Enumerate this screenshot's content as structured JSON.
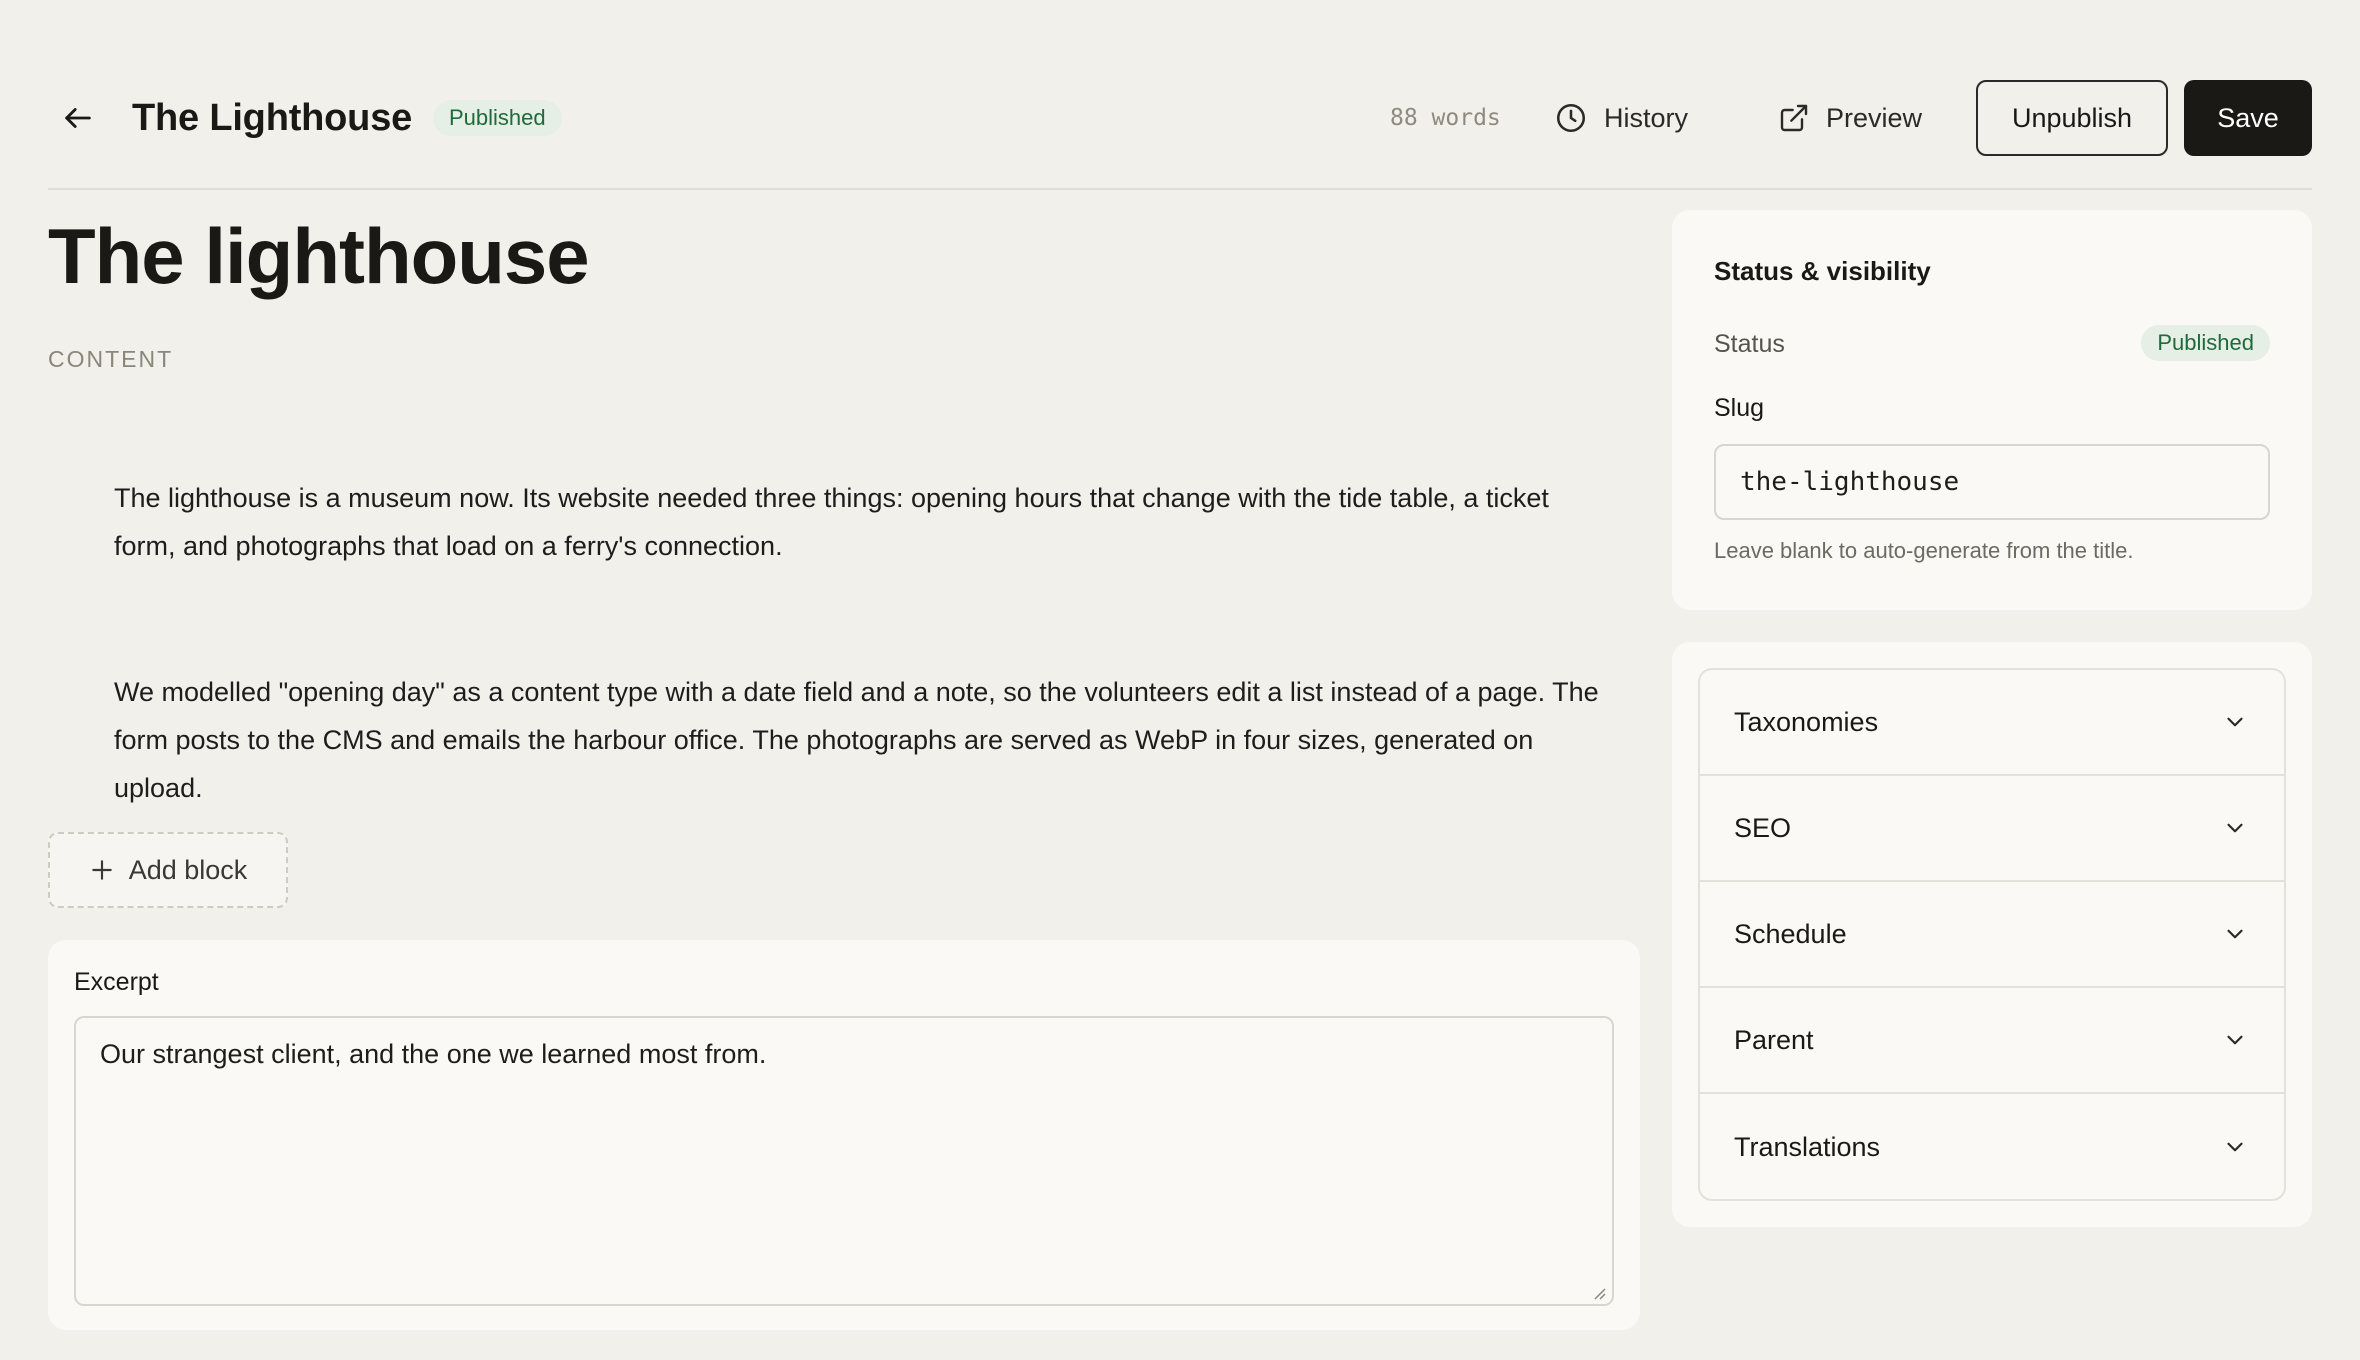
{
  "header": {
    "doc_title": "The Lighthouse",
    "doc_status": "Published",
    "word_count": "88 words",
    "history_label": "History",
    "preview_label": "Preview",
    "unpublish_label": "Unpublish",
    "save_label": "Save"
  },
  "editor": {
    "page_title": "The lighthouse",
    "section_label": "CONTENT",
    "paragraphs": [
      "The lighthouse is a museum now. Its website needed three things: opening hours that change with the tide table, a ticket form, and photographs that load on a ferry's connection.",
      "We modelled \"opening day\" as a content type with a date field and a note, so the volunteers edit a list instead of a page. The form posts to the CMS and emails the harbour office. The photographs are served as WebP in four sizes, generated on upload."
    ],
    "add_block_label": "Add block"
  },
  "excerpt": {
    "label": "Excerpt",
    "value": "Our strangest client, and the one we learned most from."
  },
  "status_panel": {
    "heading": "Status & visibility",
    "status_label": "Status",
    "status_value": "Published",
    "slug_label": "Slug",
    "slug_value": "the-lighthouse",
    "slug_hint": "Leave blank to auto-generate from the title."
  },
  "accordion": {
    "items": [
      {
        "label": "Taxonomies"
      },
      {
        "label": "SEO"
      },
      {
        "label": "Schedule"
      },
      {
        "label": "Parent"
      },
      {
        "label": "Translations"
      }
    ]
  },
  "colors": {
    "background": "#f2f0eb",
    "card": "#faf9f6",
    "primary_button": "#1a1916",
    "published_badge_bg": "#e5efe5",
    "published_badge_text": "#1f6a3a"
  },
  "icons": {
    "back": "arrow-left-icon",
    "history": "clock-icon",
    "preview": "external-link-icon",
    "add_block": "plus-icon",
    "accordion": "chevron-down-icon"
  }
}
